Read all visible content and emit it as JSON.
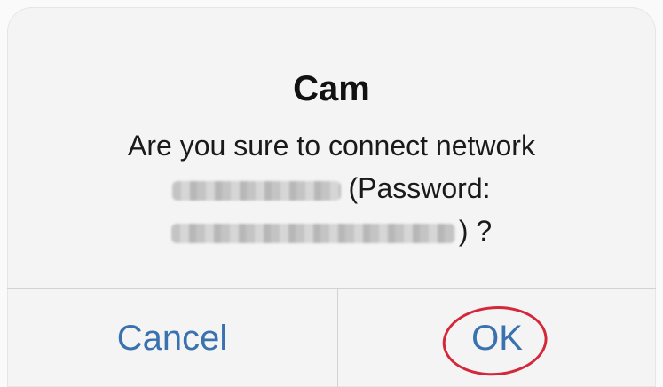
{
  "dialog": {
    "title": "Cam",
    "message": {
      "line1": "Are you sure to connect network",
      "line2_suffix": "(Password:",
      "line3_suffix": ") ?"
    },
    "buttons": {
      "cancel_label": "Cancel",
      "ok_label": "OK"
    },
    "colors": {
      "button_text": "#3a72b0",
      "annotation_circle": "#d4283a"
    }
  }
}
